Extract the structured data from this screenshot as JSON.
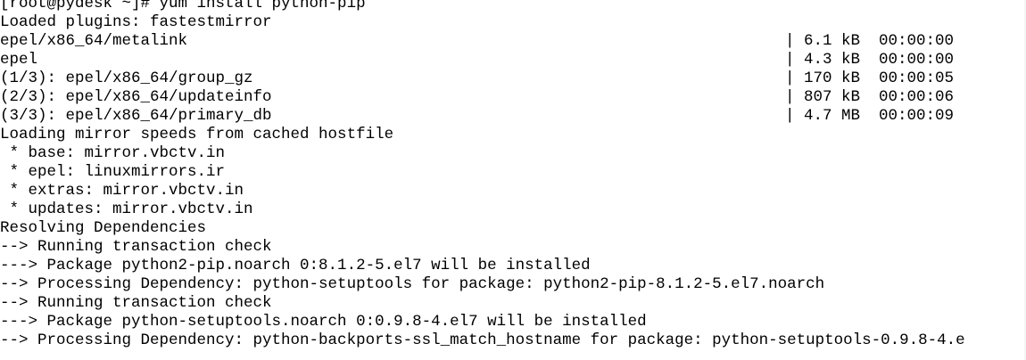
{
  "terminal": {
    "lines": {
      "l0": "[root@pydesk ~]# yum install python-pip",
      "l1": "Loaded plugins: fastestmirror",
      "l2": {
        "left": "epel/x86_64/metalink",
        "right": "| 6.1 kB  00:00:00"
      },
      "l3": {
        "left": "epel",
        "right": "| 4.3 kB  00:00:00"
      },
      "l4": {
        "left": "(1/3): epel/x86_64/group_gz",
        "right": "| 170 kB  00:00:05"
      },
      "l5": {
        "left": "(2/3): epel/x86_64/updateinfo",
        "right": "| 807 kB  00:00:06"
      },
      "l6": {
        "left": "(3/3): epel/x86_64/primary_db",
        "right": "| 4.7 MB  00:00:09"
      },
      "l7": "Loading mirror speeds from cached hostfile",
      "l8": " * base: mirror.vbctv.in",
      "l9": " * epel: linuxmirrors.ir",
      "l10": " * extras: mirror.vbctv.in",
      "l11": " * updates: mirror.vbctv.in",
      "l12": "Resolving Dependencies",
      "l13": "--> Running transaction check",
      "l14": "---> Package python2-pip.noarch 0:8.1.2-5.el7 will be installed",
      "l15": "--> Processing Dependency: python-setuptools for package: python2-pip-8.1.2-5.el7.noarch",
      "l16": "--> Running transaction check",
      "l17": "---> Package python-setuptools.noarch 0:0.9.8-4.el7 will be installed",
      "l18": "--> Processing Dependency: python-backports-ssl_match_hostname for package: python-setuptools-0.9.8-4.e"
    }
  }
}
